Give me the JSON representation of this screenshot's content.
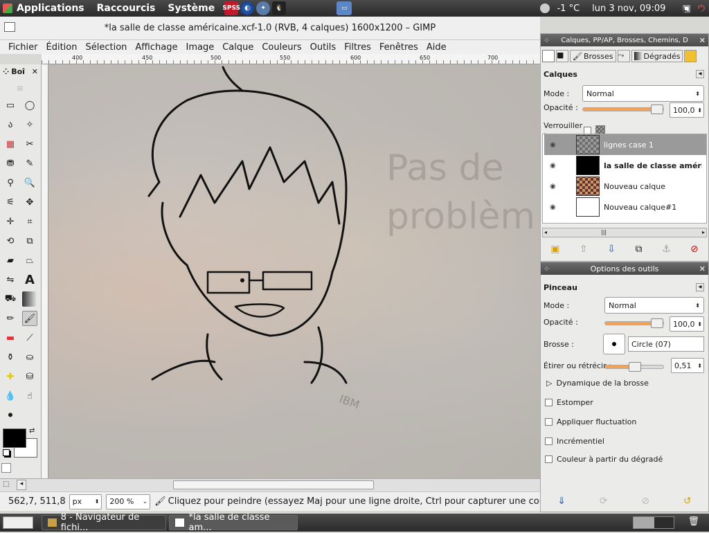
{
  "topbar": {
    "menus": [
      "Applications",
      "Raccourcis",
      "Système"
    ],
    "launcher_spss": "SPSS",
    "weather": "-1 °C",
    "clock": "lun  3 nov, 09:09"
  },
  "window": {
    "title": "*la salle de classe américaine.xcf-1.0 (RVB, 4 calques) 1600x1200 – GIMP",
    "btn_min": "–",
    "btn_max": "+",
    "btn_close": "✕"
  },
  "menubar": [
    "Fichier",
    "Édition",
    "Sélection",
    "Affichage",
    "Image",
    "Calque",
    "Couleurs",
    "Outils",
    "Filtres",
    "Fenêtres",
    "Aide"
  ],
  "ruler": [
    "400",
    "450",
    "500",
    "550",
    "600",
    "650",
    "700"
  ],
  "toolbox": {
    "title": "Boî"
  },
  "canvas": {
    "text_line1": "Pas de",
    "text_line2": "problèm",
    "ibm": "IBM"
  },
  "status": {
    "coords": "562,7, 511,8",
    "unit": "px",
    "zoom": "200 %",
    "message": "Cliquez pour peindre (essayez Maj pour une ligne droite, Ctrl pour capturer une coule"
  },
  "layers_panel": {
    "header": "Calques, PP/AP, Brosses, Chemins, D",
    "tab_brushes": "Brosses",
    "tab_gradients": "Dégradés",
    "title": "Calques",
    "mode_label": "Mode :",
    "mode_value": "Normal",
    "opacity_label": "Opacité :",
    "opacity_value": "100,0",
    "opacity_fraction": 1.0,
    "lock_label": "Verrouiller :",
    "layers": [
      {
        "name": "lignes case 1",
        "selected": true
      },
      {
        "name": "la salle de classe américain",
        "bold": true
      },
      {
        "name": "Nouveau calque"
      },
      {
        "name": "Nouveau calque#1"
      }
    ]
  },
  "tool_options": {
    "header": "Options des outils",
    "title": "Pinceau",
    "mode_label": "Mode :",
    "mode_value": "Normal",
    "opacity_label": "Opacité :",
    "opacity_value": "100,0",
    "opacity_fraction": 1.0,
    "brush_label": "Brosse :",
    "brush_value": "Circle (07)",
    "scale_label": "Étirer ou rétrécir :",
    "scale_value": "0,51",
    "scale_fraction": 0.51,
    "dynamics_label": "Dynamique de la brosse",
    "checkboxes": [
      "Estomper",
      "Appliquer fluctuation",
      "Incrémentiel",
      "Couleur à partir du dégradé"
    ]
  },
  "taskbar": {
    "items": [
      "8 - Navigateur de fichi...",
      "*la salle de classe am..."
    ]
  },
  "colors": {
    "accent": "#f3a257",
    "panel_header": "#4a4a4a",
    "selected_layer": "#9a9a9a"
  }
}
